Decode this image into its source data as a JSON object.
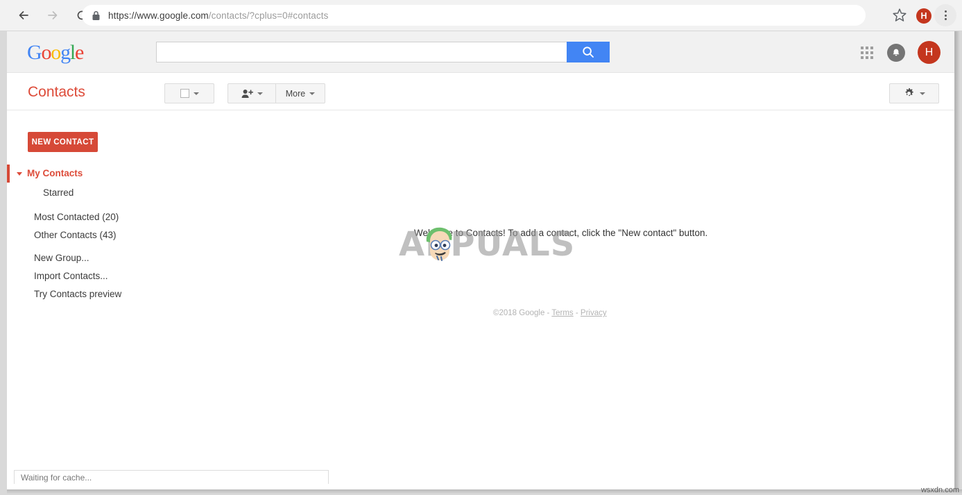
{
  "browser": {
    "back_icon": "back-arrow-icon",
    "forward_icon": "forward-arrow-icon",
    "reload_icon": "reload-icon",
    "lock_icon": "lock-icon",
    "url_domain": "https://www.google.com",
    "url_path": "/contacts/?cplus=0#contacts",
    "url_full": "https://www.google.com/contacts/?cplus=0#contacts",
    "bookmark_icon": "star-icon",
    "profile_initial": "H",
    "menu_icon": "three-dot-menu-icon"
  },
  "google_header": {
    "logo_letters": [
      "G",
      "o",
      "o",
      "g",
      "l",
      "e"
    ],
    "search_value": "",
    "search_placeholder": "",
    "search_icon": "search-icon",
    "apps_icon": "apps-grid-icon",
    "notifications_icon": "bell-icon",
    "account_initial": "H"
  },
  "contacts_toolbar": {
    "title": "Contacts",
    "select_all_icon": "checkbox-icon",
    "select_all_caret": "chevron-down-icon",
    "add_contact_icon": "add-person-icon",
    "add_contact_caret": "chevron-down-icon",
    "more_label": "More",
    "more_caret": "chevron-down-icon",
    "settings_icon": "gear-icon",
    "settings_caret": "chevron-down-icon"
  },
  "sidebar": {
    "new_contact_label": "NEW CONTACT",
    "items": [
      {
        "label": "My Contacts",
        "type": "group-header",
        "selected": true
      },
      {
        "label": "Starred",
        "type": "sub"
      },
      {
        "label": "Most Contacted (20)",
        "type": "plain"
      },
      {
        "label": "Other Contacts (43)",
        "type": "plain"
      },
      {
        "label": "New Group...",
        "type": "plain"
      },
      {
        "label": "Import Contacts...",
        "type": "plain"
      },
      {
        "label": "Try Contacts preview",
        "type": "plain"
      }
    ]
  },
  "main": {
    "welcome_message": "Welcome to Contacts! To add a contact, click the \"New contact\" button.",
    "footer": {
      "copyright": "©2018 Google",
      "separator_1": " - ",
      "terms_label": "Terms",
      "separator_2": " - ",
      "privacy_label": "Privacy"
    }
  },
  "watermark": {
    "text": "APPUALS",
    "face_icon": "cartoon-face-icon"
  },
  "status_bar": {
    "text": "Waiting for cache..."
  },
  "site_watermark": {
    "text": "wsxdn.com"
  },
  "colors": {
    "accent_red": "#DD4B39",
    "button_red": "#D64937",
    "google_blue": "#4285F4",
    "avatar_red": "#c4361e"
  }
}
